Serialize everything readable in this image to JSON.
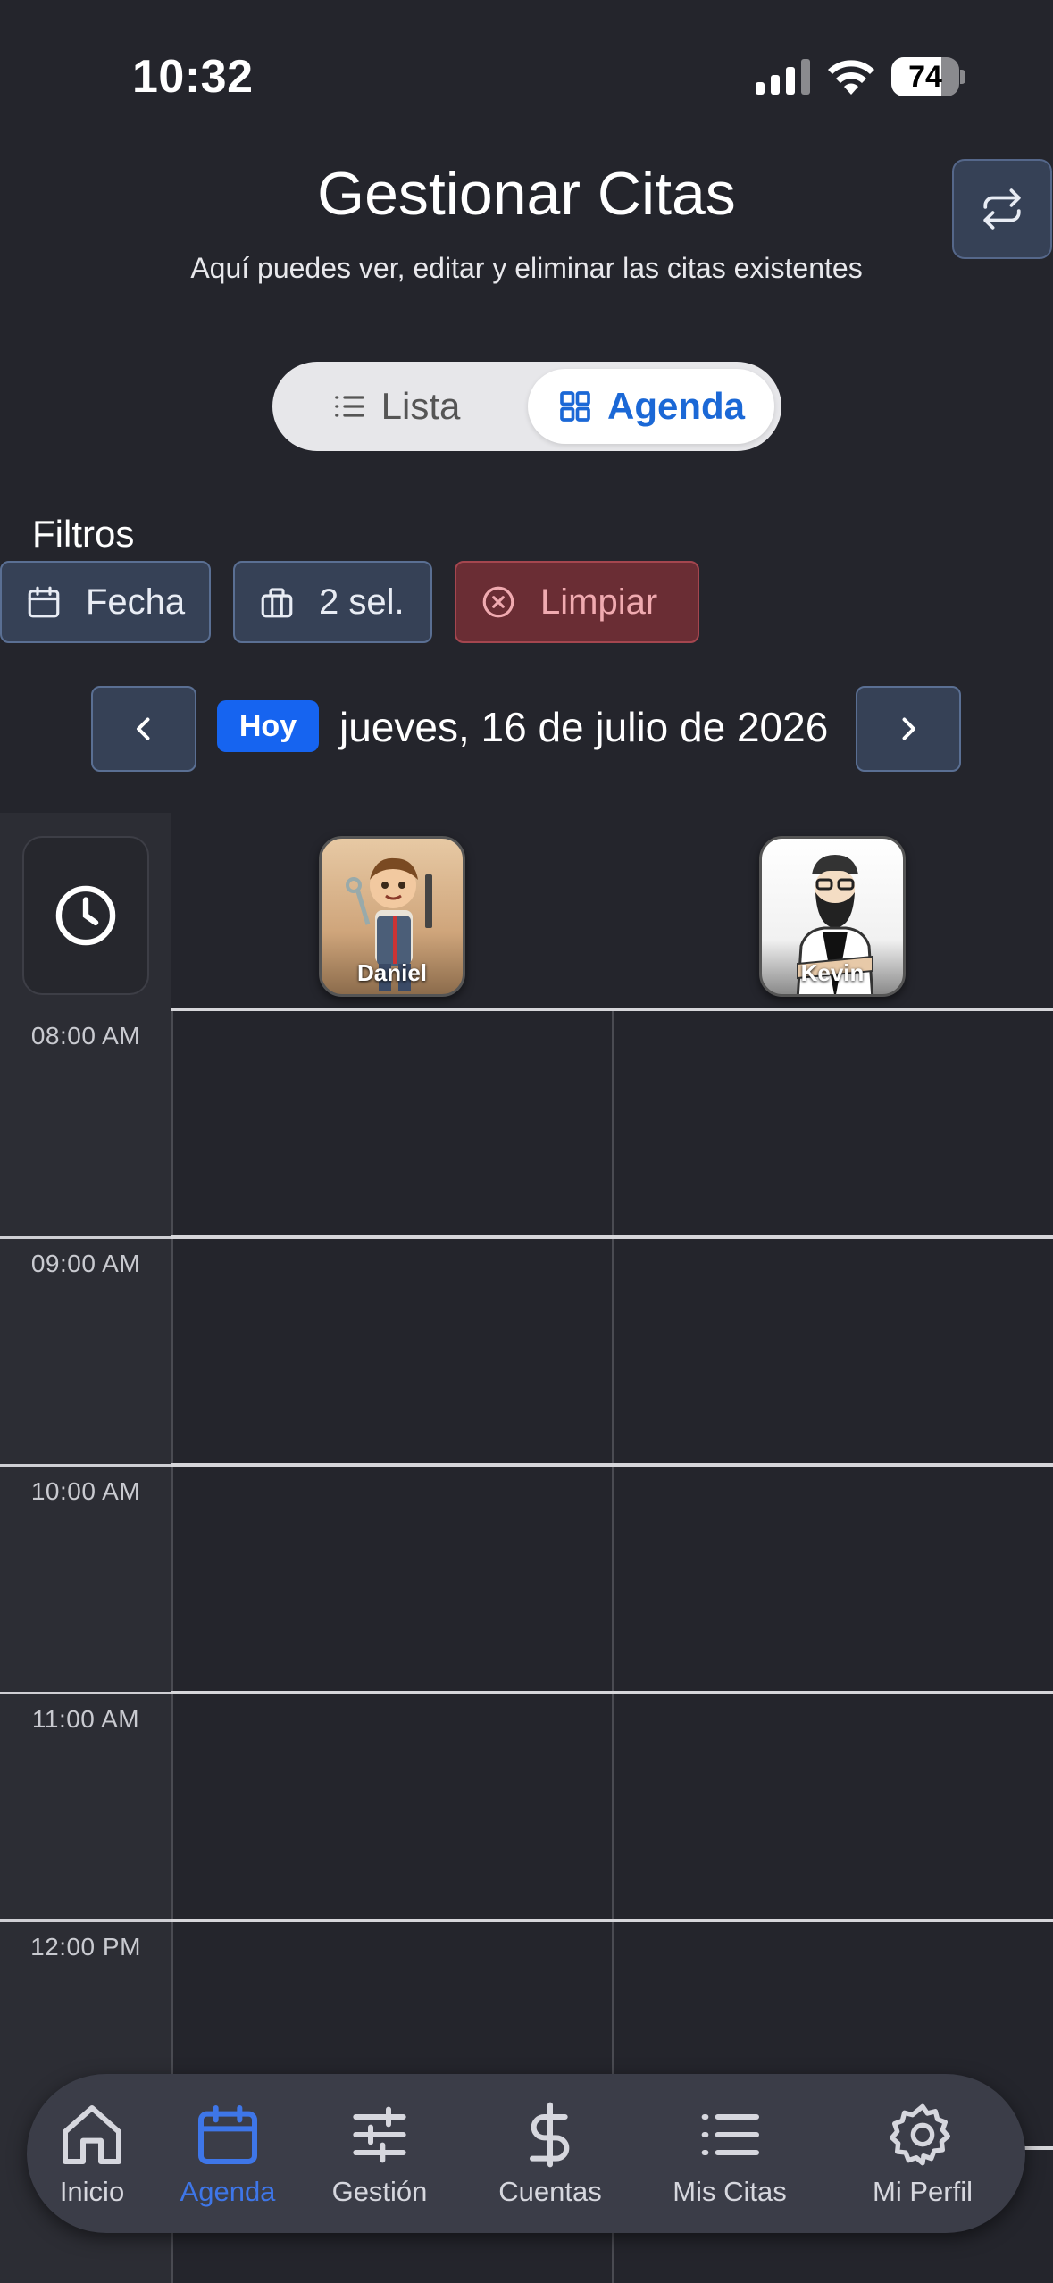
{
  "status_bar": {
    "time": "10:32",
    "battery": "74",
    "battery_level": 0.74
  },
  "header": {
    "title": "Gestionar Citas",
    "subtitle": "Aquí puedes ver, editar y eliminar las citas existentes"
  },
  "view_toggle": {
    "list_label": "Lista",
    "agenda_label": "Agenda",
    "selected": "Agenda"
  },
  "filters": {
    "label": "Filtros",
    "date_chip": "Fecha",
    "business_chip": "2 sel.",
    "clear_chip": "Limpiar"
  },
  "date_nav": {
    "today_label": "Hoy",
    "current_date": "jueves, 16 de julio de 2026"
  },
  "staff": [
    {
      "name": "Daniel"
    },
    {
      "name": "Kevin"
    }
  ],
  "time_slots": [
    "08:00 AM",
    "09:00 AM",
    "10:00 AM",
    "11:00 AM",
    "12:00 PM"
  ],
  "bottom_nav": {
    "items": [
      {
        "label": "Inicio",
        "icon": "home-icon"
      },
      {
        "label": "Agenda",
        "icon": "calendar-icon",
        "active": true
      },
      {
        "label": "Gestión",
        "icon": "sliders-icon"
      },
      {
        "label": "Cuentas",
        "icon": "dollar-icon"
      },
      {
        "label": "Mis Citas",
        "icon": "list-icon"
      },
      {
        "label": "Mi Perfil",
        "icon": "gear-icon"
      }
    ]
  },
  "colors": {
    "background": "#24252c",
    "accent": "#1b68d6",
    "today_badge": "#1664f0",
    "nav_active": "#3e76e8",
    "clear_chip": "#6a2d34"
  }
}
